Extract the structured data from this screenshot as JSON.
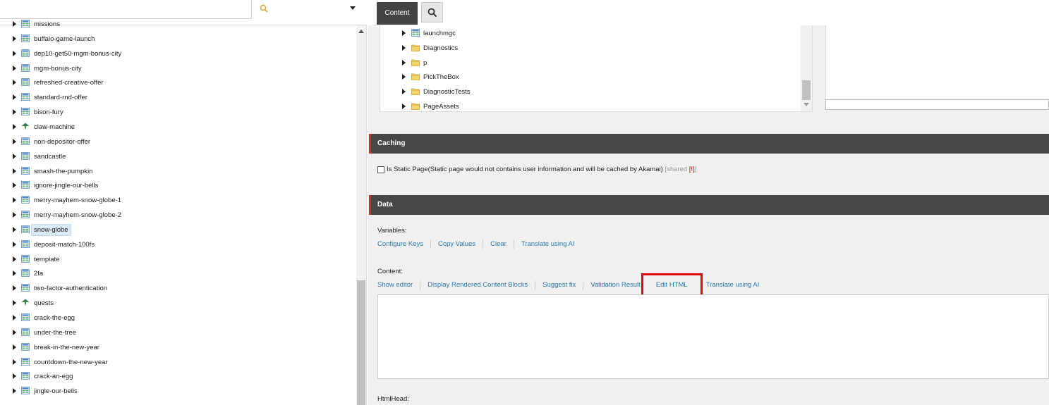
{
  "search": {
    "value": "",
    "placeholder": ""
  },
  "tree": {
    "items": [
      {
        "label": "missions",
        "icon": "template-icon"
      },
      {
        "label": "buffalo-game-launch",
        "icon": "template-icon"
      },
      {
        "label": "dep10-get50-mgm-bonus-city",
        "icon": "template-icon"
      },
      {
        "label": "mgm-bonus-city",
        "icon": "template-icon"
      },
      {
        "label": "refreshed-creative-offer",
        "icon": "template-icon"
      },
      {
        "label": "standard-rnd-offer",
        "icon": "template-icon"
      },
      {
        "label": "bison-fury",
        "icon": "template-icon"
      },
      {
        "label": "claw-machine",
        "icon": "tree-node-icon"
      },
      {
        "label": "non-depositor-offer",
        "icon": "template-icon"
      },
      {
        "label": "sandcastle",
        "icon": "template-icon"
      },
      {
        "label": "smash-the-pumpkin",
        "icon": "template-icon"
      },
      {
        "label": "ignore-jingle-our-bells",
        "icon": "template-icon"
      },
      {
        "label": "merry-mayhem-snow-globe-1",
        "icon": "template-icon"
      },
      {
        "label": "merry-mayhem-snow-globe-2",
        "icon": "template-icon"
      },
      {
        "label": "snow-globe",
        "icon": "template-icon",
        "selected": true
      },
      {
        "label": "deposit-match-100fs",
        "icon": "template-icon"
      },
      {
        "label": "template",
        "icon": "template-icon"
      },
      {
        "label": "2fa",
        "icon": "template-icon"
      },
      {
        "label": "two-factor-authentication",
        "icon": "template-icon"
      },
      {
        "label": "quests",
        "icon": "tree-node-icon"
      },
      {
        "label": "crack-the-egg",
        "icon": "template-icon"
      },
      {
        "label": "under-the-tree",
        "icon": "template-icon"
      },
      {
        "label": "break-in-the-new-year",
        "icon": "template-icon"
      },
      {
        "label": "countdown-the-new-year",
        "icon": "template-icon"
      },
      {
        "label": "crack-an-egg",
        "icon": "template-icon"
      },
      {
        "label": "jingle-our-bells",
        "icon": "template-icon"
      }
    ]
  },
  "tabs": {
    "content": "Content"
  },
  "subtree": {
    "items": [
      {
        "label": "launchmgc",
        "icon": "template-icon"
      },
      {
        "label": "Diagnostics",
        "icon": "folder-icon"
      },
      {
        "label": "p",
        "icon": "folder-icon"
      },
      {
        "label": "PickTheBox",
        "icon": "folder-icon"
      },
      {
        "label": "DiagnosticTests",
        "icon": "folder-icon"
      },
      {
        "label": "PageAssets",
        "icon": "folder-icon"
      }
    ]
  },
  "caching": {
    "header": "Caching",
    "static_label": "Is Static Page(Static page would not contains user information and will be cached by Akamai)",
    "shared_prefix": "[shared",
    "shared_num": "[!]",
    "shared_suffix": "]"
  },
  "data": {
    "header": "Data",
    "variables_label": "Variables:",
    "variables_links": [
      "Configure Keys",
      "Copy Values",
      "Clear",
      "Translate using AI"
    ],
    "content_label": "Content:",
    "content_links": [
      "Show editor",
      "Display Rendered Content Blocks",
      "Suggest fix",
      "Validation Result",
      "Edit HTML",
      "Translate using AI"
    ],
    "htmlhead_label": "HtmlHead:"
  },
  "colors": {
    "header_bg": "#474747",
    "header_accent": "#c9302c",
    "link": "#2a7ab0",
    "highlight": "#e0000b"
  }
}
